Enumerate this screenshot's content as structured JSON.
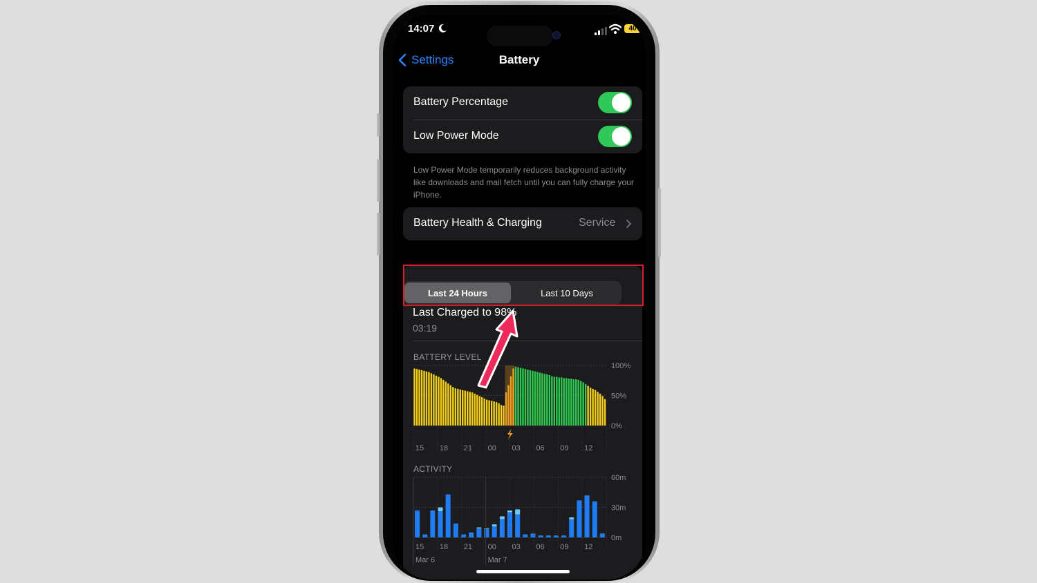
{
  "status_bar": {
    "time": "14:07",
    "battery": "40"
  },
  "nav": {
    "back_label": "Settings",
    "title": "Battery"
  },
  "settings": {
    "battery_percentage": {
      "label": "Battery Percentage",
      "enabled": true
    },
    "low_power_mode": {
      "label": "Low Power Mode",
      "enabled": true
    },
    "low_power_footnote": "Low Power Mode temporarily reduces background activity like downloads and mail fetch until you can fully charge your iPhone.",
    "battery_health": {
      "label": "Battery Health & Charging",
      "value": "Service"
    }
  },
  "usage": {
    "segments": [
      "Last 24 Hours",
      "Last 10 Days"
    ],
    "selected_segment": 0,
    "last_charged_label": "Last Charged to 98%",
    "last_charged_time": "03:19"
  },
  "colors": {
    "accent": "#2f84ff",
    "toggle_on": "#31c85a",
    "battery_low_power": "#f5cf1b",
    "battery_normal": "#30c74f",
    "charging": "#f0a020",
    "activity_screen_on": "#1f7cf2",
    "activity_screen_off": "#6fc6f7",
    "highlight_box": "#d61e2f",
    "annotation_arrow": "#ee2a5a"
  },
  "chart_data": [
    {
      "type": "bar",
      "title": "BATTERY LEVEL",
      "y_tick_labels": [
        "100%",
        "50%",
        "0%"
      ],
      "ylim": [
        0,
        100
      ],
      "x_tick_labels": [
        "15",
        "18",
        "21",
        "00",
        "03",
        "06",
        "09",
        "12"
      ],
      "charging_icon": "lightning-icon",
      "charging_start_index": 38,
      "charging_end_index": 42,
      "values": [
        95,
        94,
        93,
        92,
        91,
        90,
        89,
        87,
        85,
        83,
        81,
        79,
        76,
        73,
        70,
        67,
        64,
        62,
        61,
        60,
        59,
        58,
        57,
        56,
        55,
        53,
        51,
        49,
        47,
        45,
        43,
        42,
        41,
        40,
        39,
        37,
        34,
        33,
        55,
        67,
        82,
        95,
        98,
        97,
        96,
        95,
        94,
        93,
        92,
        91,
        90,
        89,
        88,
        87,
        86,
        85,
        84,
        82,
        81,
        81,
        80,
        80,
        79,
        79,
        78,
        78,
        77,
        77,
        76,
        74,
        72,
        69,
        66,
        63,
        61,
        59,
        56,
        53,
        49,
        44
      ],
      "series_colors": "yellow = Low Power Mode, green = normal, orange = charging"
    },
    {
      "type": "bar",
      "title": "ACTIVITY",
      "y_tick_labels": [
        "60m",
        "30m",
        "0m"
      ],
      "ylim": [
        0,
        60
      ],
      "x_tick_labels": [
        "15",
        "18",
        "21",
        "00",
        "03",
        "06",
        "09",
        "12"
      ],
      "date_labels": [
        "Mar 6",
        "Mar 7"
      ],
      "series": [
        {
          "values": [
            27,
            3,
            27,
            26,
            43,
            14,
            3,
            5,
            9,
            8,
            11,
            18,
            25,
            23,
            3,
            4,
            2,
            2,
            2,
            2,
            18,
            37,
            42,
            36,
            4
          ]
        },
        {
          "values": [
            0,
            0,
            0,
            4,
            0,
            0,
            0,
            0,
            1,
            1,
            2,
            3,
            2,
            5,
            0,
            0,
            0,
            0,
            0,
            0,
            2,
            0,
            0,
            0,
            0
          ]
        }
      ]
    }
  ]
}
